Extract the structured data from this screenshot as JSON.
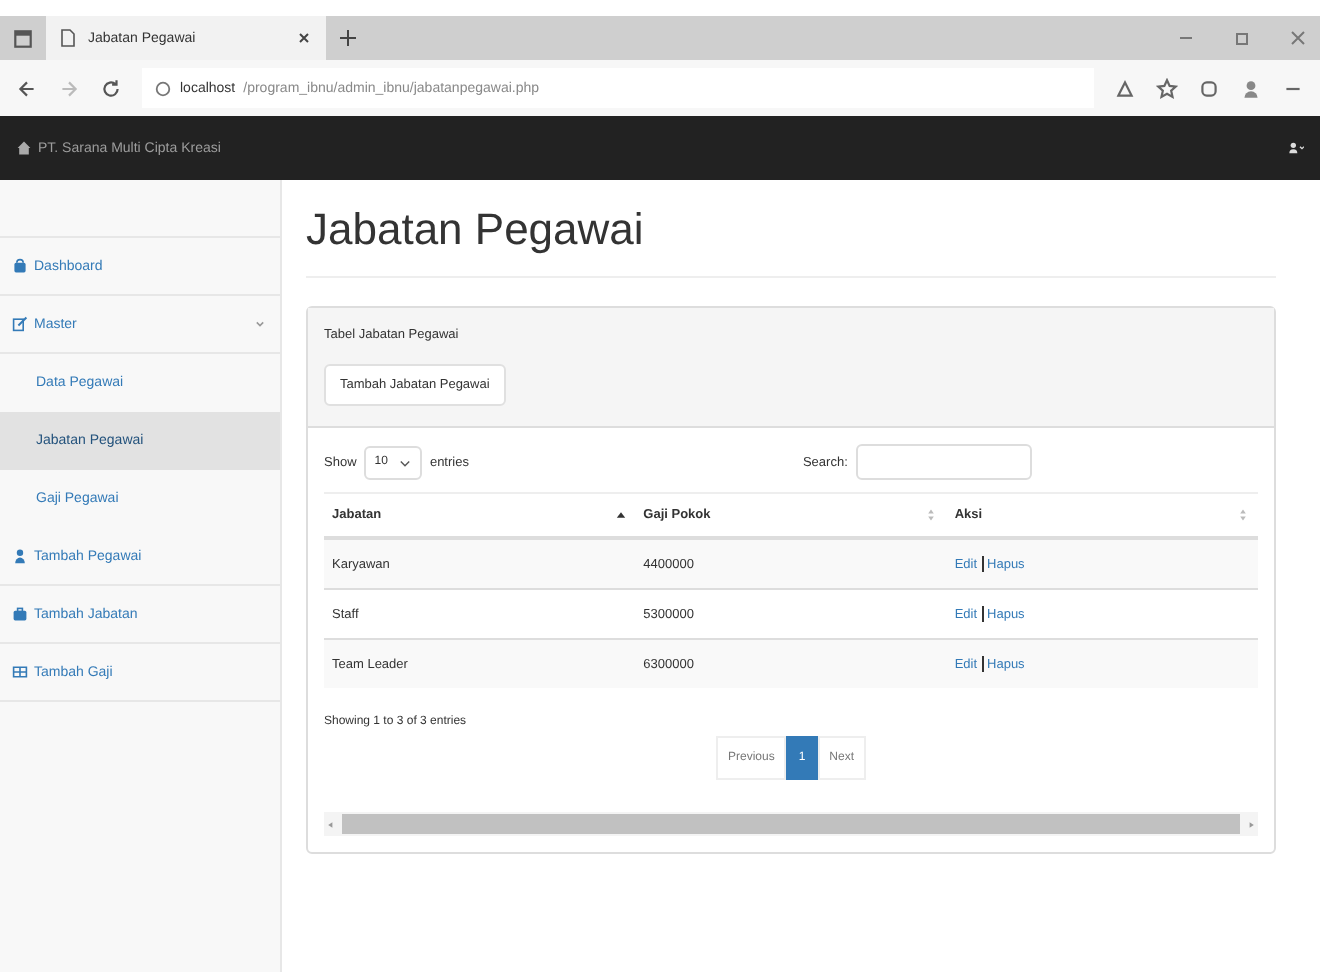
{
  "browser": {
    "tab_title": "Jabatan Pegawai",
    "url_host": "localhost",
    "url_path": "/program_ibnu/admin_ibnu/jabatanpegawai.php"
  },
  "navbar": {
    "brand": "PT. Sarana Multi Cipta Kreasi"
  },
  "sidebar": {
    "items": [
      {
        "label": "Dashboard",
        "selected": false
      },
      {
        "label": "Master",
        "selected": false,
        "expanded": true,
        "children": [
          {
            "label": "Data Pegawai",
            "selected": false
          },
          {
            "label": "Jabatan Pegawai",
            "selected": true
          },
          {
            "label": "Gaji Pegawai",
            "selected": false
          }
        ]
      },
      {
        "label": "Tambah Pegawai",
        "selected": false
      },
      {
        "label": "Tambah Jabatan",
        "selected": false
      },
      {
        "label": "Tambah Gaji",
        "selected": false
      }
    ]
  },
  "page_title": "Jabatan Pegawai",
  "panel": {
    "heading": "Tabel Jabatan Pegawai",
    "add_button": "Tambah Jabatan Pegawai",
    "length": {
      "show": "Show",
      "value": "10",
      "entries": "entries"
    },
    "search": {
      "label": "Search:"
    },
    "table": {
      "columns": [
        {
          "label": "Jabatan",
          "sorted": true
        },
        {
          "label": "Gaji Pokok",
          "sorted": false
        },
        {
          "label": "Aksi",
          "sorted": false
        }
      ],
      "rows": [
        {
          "jabatan": "Karyawan",
          "gaji": "4400000",
          "actions": [
            "Edit",
            "Hapus"
          ]
        },
        {
          "jabatan": "Staff",
          "gaji": "5300000",
          "actions": [
            "Edit",
            "Hapus"
          ]
        },
        {
          "jabatan": "Team Leader",
          "gaji": "6300000",
          "actions": [
            "Edit",
            "Hapus"
          ]
        }
      ]
    },
    "info": "Showing 1 to 3 of 3 entries",
    "pagination": [
      {
        "label": "Previous",
        "selected": false
      },
      {
        "label": "1",
        "selected": true
      },
      {
        "label": "Next",
        "selected": false
      }
    ]
  }
}
